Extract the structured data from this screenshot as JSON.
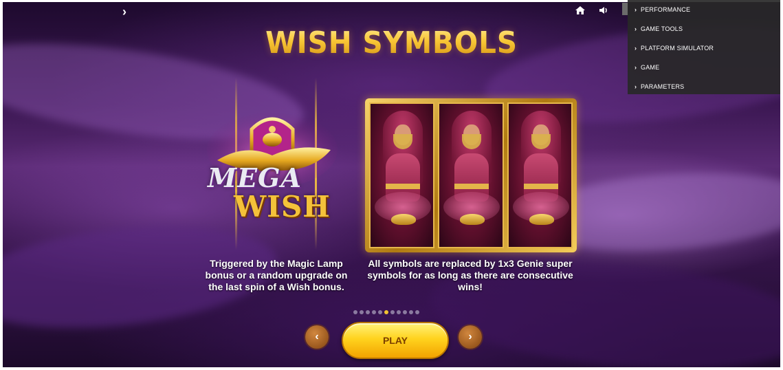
{
  "title": "WISH SYMBOLS",
  "colors": {
    "title_gold": "#f6c930",
    "play_yellow": "#ffd31e",
    "nav_orange": "#c97b34",
    "active_dot": "#f2c232",
    "menu_bg": "#282828"
  },
  "top_bar": {
    "expand_icon": "chevron-right-icon",
    "home_icon": "home-icon",
    "sound_icon": "speaker-icon"
  },
  "dev_menu": {
    "items": [
      {
        "label": "PERFORMANCE"
      },
      {
        "label": "GAME TOOLS"
      },
      {
        "label": "PLATFORM SIMULATOR"
      },
      {
        "label": "GAME"
      },
      {
        "label": "PARAMETERS"
      }
    ]
  },
  "logo": {
    "line1": "MEGA",
    "line2": "WISH"
  },
  "descriptions": {
    "left": "Triggered by the Magic Lamp bonus or a random upgrade on the last spin of a Wish bonus.",
    "right": "All symbols are replaced by 1x3 Genie super symbols for as long as there are consecutive wins!"
  },
  "pager": {
    "total": 11,
    "active_index": 5
  },
  "controls": {
    "prev_label": "‹",
    "next_label": "›",
    "play_label": "PLAY"
  }
}
